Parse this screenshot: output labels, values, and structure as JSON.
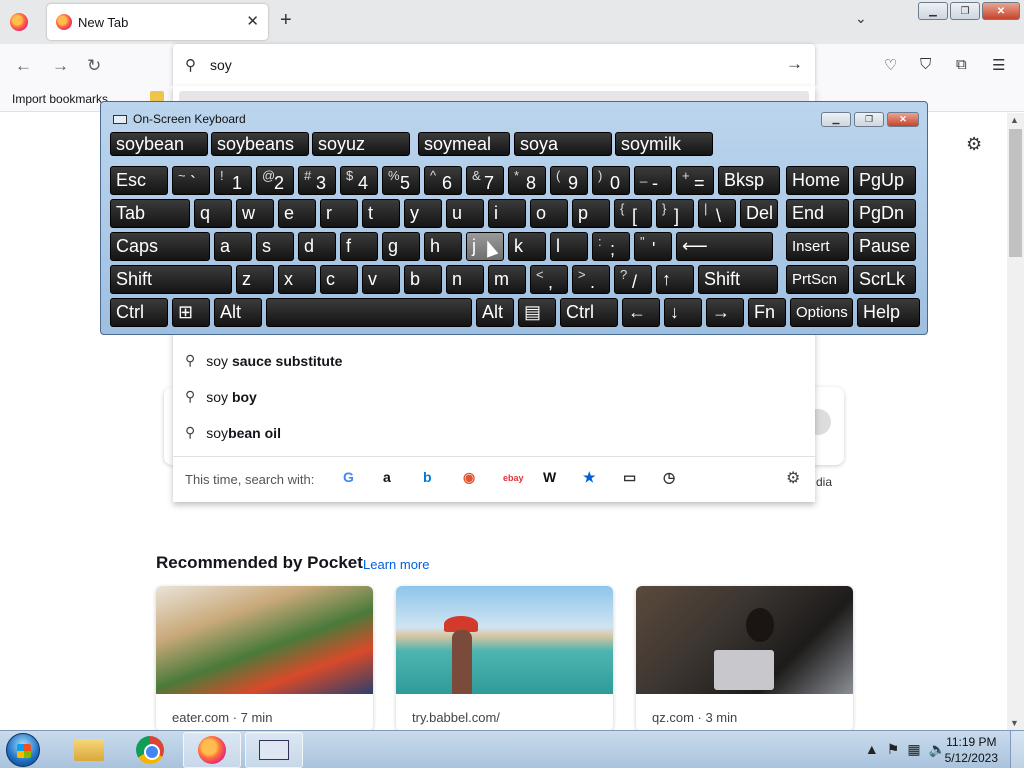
{
  "browser": {
    "tab_title": "New Tab",
    "address_value": "soy",
    "bookmarks_import": "Import bookmarks..."
  },
  "keyboard": {
    "title": "On-Screen Keyboard",
    "predictions": [
      "soybean",
      "soybeans",
      "soyuz",
      "soymeal",
      "soya",
      "soymilk"
    ],
    "rows": [
      [
        "Esc",
        "~ `",
        "! 1",
        "@ 2",
        "# 3",
        "$ 4",
        "% 5",
        "^ 6",
        "& 7",
        "* 8",
        "( 9",
        ") 0",
        "_ -",
        "+ =",
        "Bksp",
        "Home",
        "PgUp"
      ],
      [
        "Tab",
        "q",
        "w",
        "e",
        "r",
        "t",
        "y",
        "u",
        "i",
        "o",
        "p",
        "{ [",
        "} ]",
        "| \\",
        "Del",
        "End",
        "PgDn"
      ],
      [
        "Caps",
        "a",
        "s",
        "d",
        "f",
        "g",
        "h",
        "j",
        "k",
        "l",
        ": ;",
        "\" '",
        "⟵",
        "Insert",
        "Pause"
      ],
      [
        "Shift",
        "z",
        "x",
        "c",
        "v",
        "b",
        "n",
        "m",
        "< ,",
        "> .",
        "? /",
        "↑",
        "Shift",
        "PrtScn",
        "ScrLk"
      ],
      [
        "Ctrl",
        "⊞",
        "Alt",
        "",
        "Alt",
        "▤",
        "Ctrl",
        "←",
        "↓",
        "→",
        "Fn",
        "Options",
        "Help"
      ]
    ],
    "pressed_key": "j"
  },
  "suggestions": [
    {
      "prefix": "soy",
      "bold": " sauce substitute"
    },
    {
      "prefix": "soy",
      "bold": " boy"
    },
    {
      "prefix": "soy",
      "bold": "bean oil"
    }
  ],
  "search_with_label": "This time, search with:",
  "search_engines": [
    {
      "name": "google-icon",
      "glyph": "G",
      "color": "#4285f4"
    },
    {
      "name": "amazon-icon",
      "glyph": "a",
      "color": "#111111"
    },
    {
      "name": "bing-icon",
      "glyph": "b",
      "color": "#0078d4"
    },
    {
      "name": "duckduckgo-icon",
      "glyph": "◉",
      "color": "#de5833"
    },
    {
      "name": "ebay-icon",
      "glyph": "ebay",
      "color": "#e53238"
    },
    {
      "name": "wikipedia-icon",
      "glyph": "W",
      "color": "#111111"
    },
    {
      "name": "bookmarks-star-icon",
      "glyph": "★",
      "color": "#0061e0"
    },
    {
      "name": "tabs-icon",
      "glyph": "▭",
      "color": "#333333"
    },
    {
      "name": "history-icon",
      "glyph": "◷",
      "color": "#333333"
    }
  ],
  "shortcut_partial_label": "dia",
  "pocket": {
    "title": "Recommended by Pocket",
    "learn_more": "Learn more",
    "stories": [
      {
        "source": "eater.com · 7 min"
      },
      {
        "source": "try.babbel.com/"
      },
      {
        "source": "qz.com · 3 min"
      }
    ]
  },
  "taskbar": {
    "time": "11:19 PM",
    "date": "5/12/2023"
  }
}
